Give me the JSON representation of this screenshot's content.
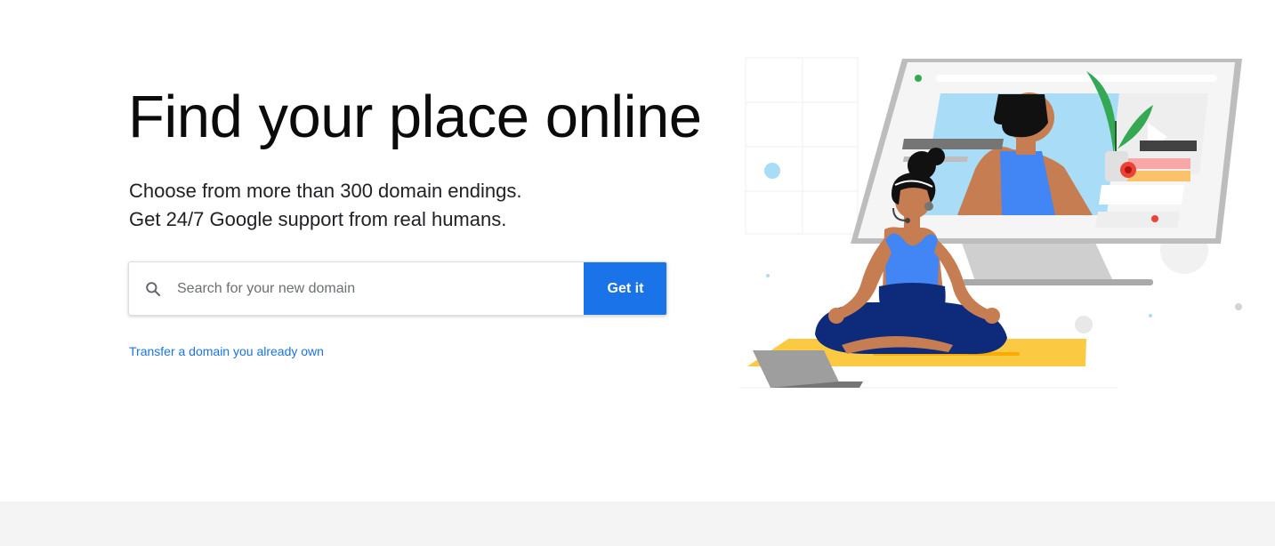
{
  "hero": {
    "title": "Find your place online",
    "subtitle_line1": "Choose from more than 300 domain endings.",
    "subtitle_line2": "Get 24/7 Google support from real humans."
  },
  "search": {
    "icon": "search-icon",
    "placeholder": "Search for your new domain",
    "value": "",
    "button_label": "Get it"
  },
  "transfer_link": "Transfer a domain you already own",
  "colors": {
    "accent": "#1a73e8",
    "title": "#0b0b0b",
    "footer_band": "#f4f4f4"
  }
}
